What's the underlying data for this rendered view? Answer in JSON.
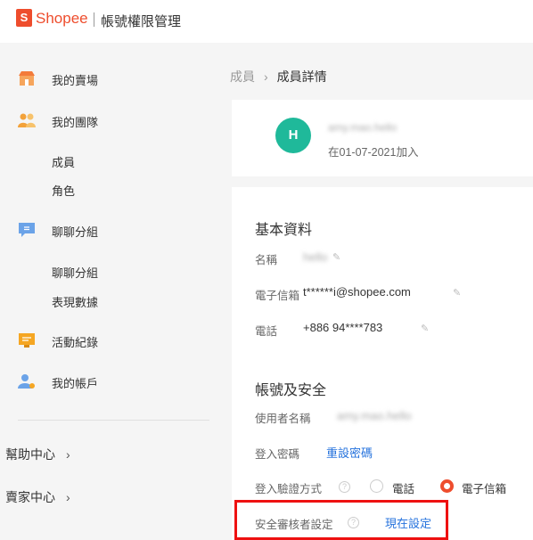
{
  "header": {
    "logo_letter": "S",
    "brand": "Shopee",
    "subtitle": "帳號權限管理"
  },
  "sidebar": {
    "items": [
      {
        "label": "我的賣場",
        "icon": "shop-icon"
      },
      {
        "label": "我的團隊",
        "icon": "team-icon"
      },
      {
        "label": "聊聊分組",
        "icon": "chat-icon"
      },
      {
        "label": "活動紀錄",
        "icon": "activity-log-icon"
      },
      {
        "label": "我的帳戶",
        "icon": "account-icon"
      }
    ],
    "team_sub": [
      "成員",
      "角色"
    ],
    "chat_sub": [
      "聊聊分組",
      "表現數據"
    ],
    "footer": {
      "help_center": "幫助中心",
      "seller_center": "賣家中心",
      "chevron": "›"
    }
  },
  "breadcrumb": {
    "parent": "成員",
    "separator": "›",
    "current": "成員詳情"
  },
  "member": {
    "avatar_letter": "H",
    "username": "amy.mao.hello",
    "joined": "在01-07-2021加入"
  },
  "basic_info": {
    "title": "基本資料",
    "name_label": "名稱",
    "name_value": "hello",
    "email_label": "電子信箱",
    "email_value": "t******i@shopee.com",
    "phone_label": "電話",
    "phone_value": "+886 94****783"
  },
  "security": {
    "title": "帳號及安全",
    "username_label": "使用者名稱",
    "username_value": "amy.mao.hello",
    "password_label": "登入密碼",
    "password_link": "重設密碼",
    "verify_label": "登入驗證方式",
    "verify_options": [
      "電話",
      "電子信箱"
    ],
    "verify_selected": "電子信箱",
    "reviewer_label": "安全審核者設定",
    "reviewer_link": "現在設定"
  },
  "colors": {
    "brand": "#ee4d2d",
    "link": "#2673dd",
    "avatar": "#1fb99a",
    "highlight": "#ee1111"
  }
}
